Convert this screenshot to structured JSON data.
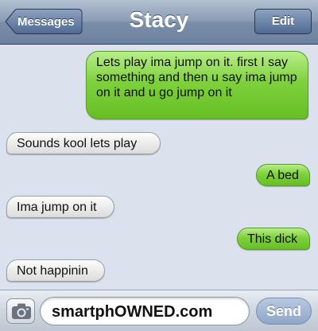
{
  "header": {
    "back_label": "Messages",
    "title": "Stacy",
    "edit_label": "Edit"
  },
  "messages": [
    {
      "from": "me",
      "text": "Lets play ima jump on it. first I say something and then u say ima jump on it and u go jump on it"
    },
    {
      "from": "them",
      "text": "Sounds kool lets play"
    },
    {
      "from": "me",
      "text": "A bed"
    },
    {
      "from": "them",
      "text": "Ima jump on it"
    },
    {
      "from": "me",
      "text": "This dick"
    },
    {
      "from": "them",
      "text": "Not happinin"
    }
  ],
  "composer": {
    "camera_icon": "camera-icon",
    "input_value": "smartphOWNED.com",
    "send_label": "Send"
  },
  "colors": {
    "sent_bubble": "#7ed13c",
    "received_bubble": "#ececec",
    "background": "#dbe2ed",
    "navbar": "#8a9bb3"
  }
}
